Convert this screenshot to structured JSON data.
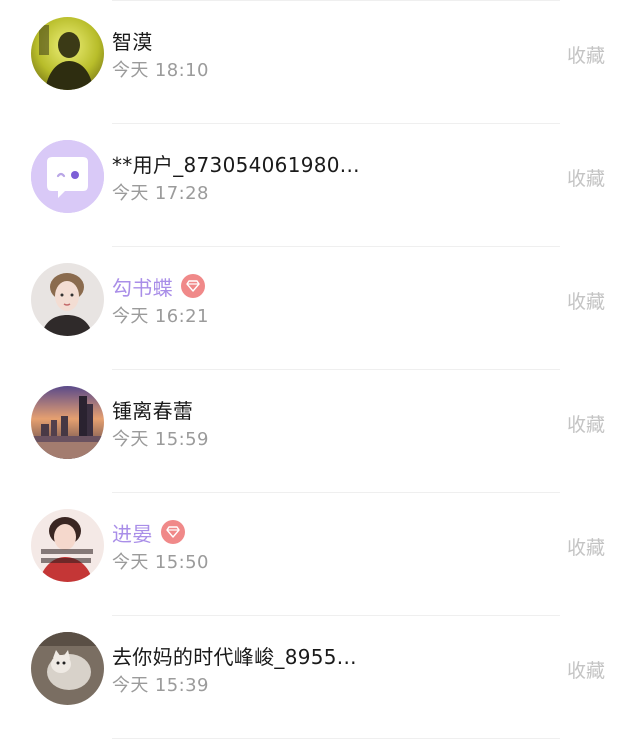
{
  "visitors": [
    {
      "name": "智漠",
      "time": "今天 18:10",
      "action": "收藏",
      "vip": false,
      "avatar": "photo-avatar-man-yellow"
    },
    {
      "name": "**用户_873054061980...",
      "time": "今天 17:28",
      "action": "收藏",
      "vip": false,
      "avatar": "default-chat-bubble-avatar"
    },
    {
      "name": "勾书蝶",
      "time": "今天 16:21",
      "action": "收藏",
      "vip": true,
      "avatar": "photo-avatar-woman"
    },
    {
      "name": "锺离春蕾",
      "time": "今天 15:59",
      "action": "收藏",
      "vip": false,
      "avatar": "photo-avatar-city-skyline"
    },
    {
      "name": "进晏",
      "time": "今天 15:50",
      "action": "收藏",
      "vip": true,
      "avatar": "photo-avatar-woman-text"
    },
    {
      "name": "去你妈的时代峰峻_8955...",
      "time": "今天 15:39",
      "action": "收藏",
      "vip": false,
      "avatar": "photo-avatar-cat"
    }
  ],
  "colors": {
    "vip_name": "#a98ee8",
    "vip_badge": "#f08989",
    "time_text": "#9b9b9b",
    "action_text": "#c4c4c4",
    "default_avatar_bg": "#d9c9f7"
  }
}
